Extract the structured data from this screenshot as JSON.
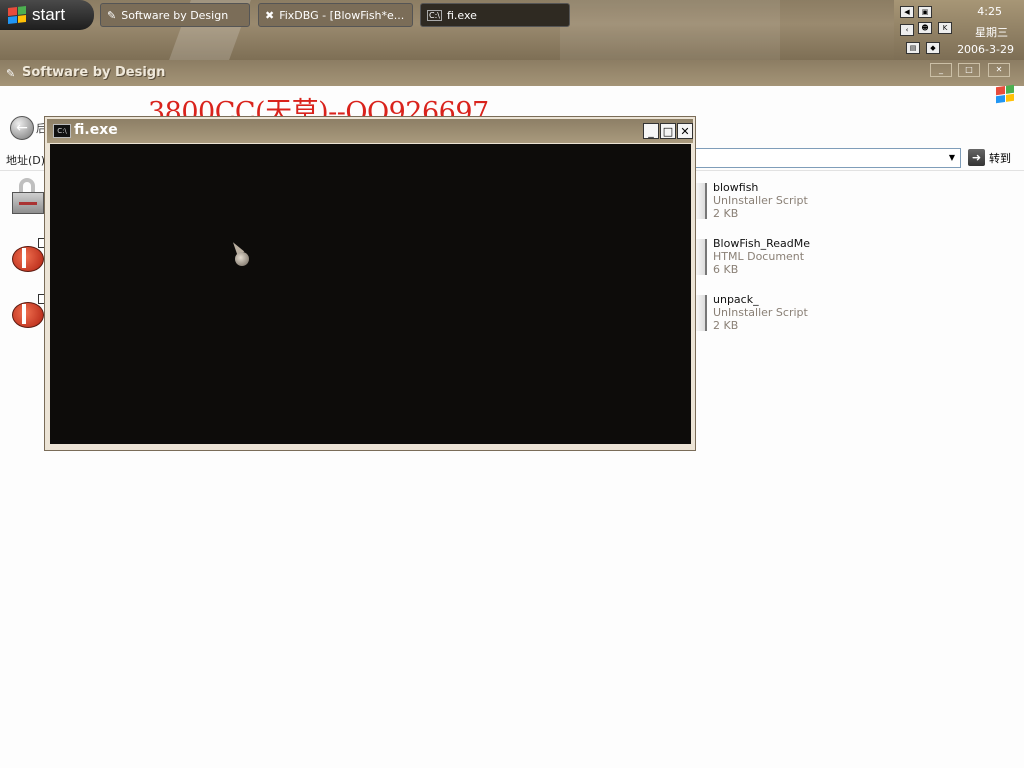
{
  "taskbar": {
    "start_label": "start",
    "tasks": [
      {
        "label": "Software by Design"
      },
      {
        "label": "FixDBG - [BlowFish*e..."
      },
      {
        "label": "fi.exe"
      }
    ],
    "clock": "4:25",
    "weekday": "星期三",
    "date": "2006-3-29"
  },
  "explorer": {
    "title": "Software by Design",
    "back_label": "后",
    "address_label": "地址(D)",
    "address_value": "",
    "go_label": "转到",
    "files": [
      {
        "name": "blowfish",
        "type": "UnInstaller Script",
        "size": "2 KB"
      },
      {
        "name": "BlowFish_ReadMe",
        "type": "HTML Document",
        "size": "6 KB"
      },
      {
        "name": "unpack_",
        "type": "UnInstaller Script",
        "size": "2 KB"
      }
    ]
  },
  "watermark": "3800CC(天草)--QQ926697",
  "console": {
    "title": "fi.exe",
    "icon_text": "C:\\",
    "minimize": "_",
    "maximize": "□",
    "close": "✕"
  },
  "colors": {
    "taskbar": "#8c7d63",
    "watermark": "#d9231c",
    "console_bg": "#0d0c0a",
    "file_meta": "#8a8076"
  }
}
